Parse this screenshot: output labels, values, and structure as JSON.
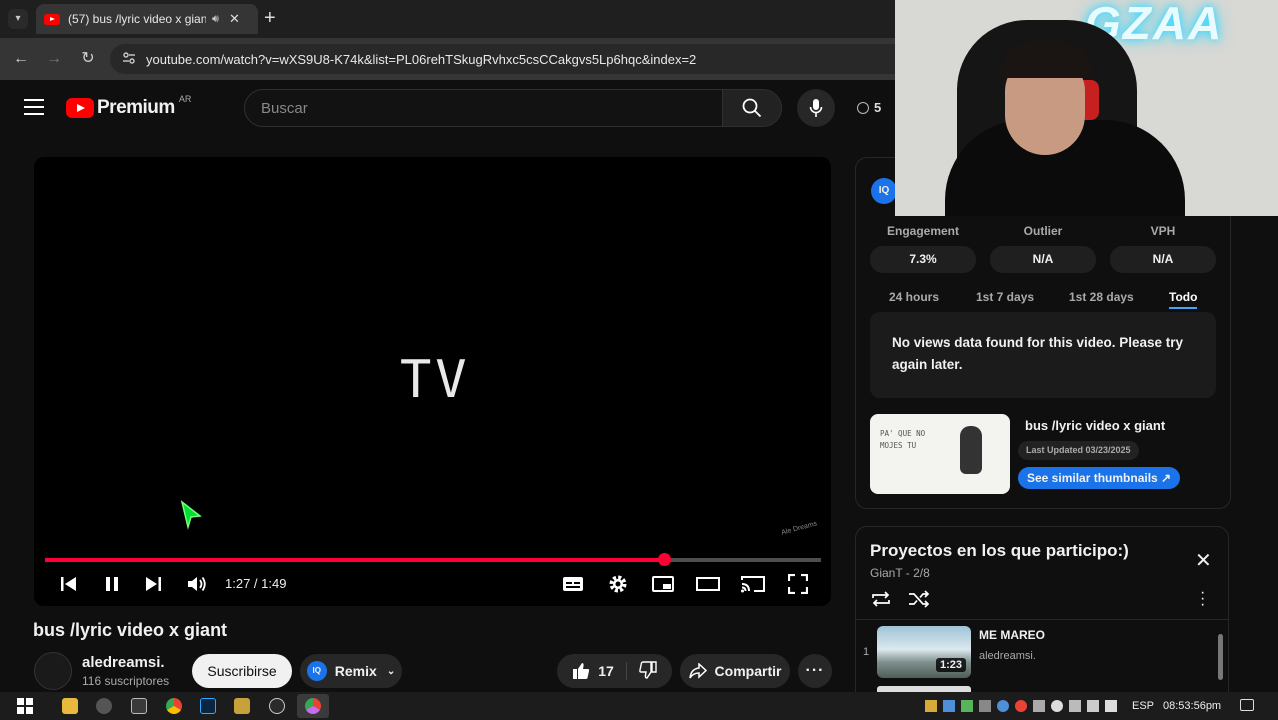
{
  "browser": {
    "tab_title": "(57) bus /lyric video x giant",
    "url": "youtube.com/watch?v=wXS9U8-K74k&list=PL06rehTSkugRvhxc5csCCakgvs5Lp6hqc&index=2"
  },
  "header": {
    "logo_text": "Premium",
    "region": "AR",
    "search_placeholder": "Buscar",
    "history_count": "5"
  },
  "player": {
    "lyric_text": "TV",
    "current_time": "1:27",
    "duration": "1:49",
    "time_display": "1:27 / 1:49",
    "progress_fraction": 0.798,
    "watermark": "Ale Dreams"
  },
  "video": {
    "title": "bus /lyric video x giant",
    "channel": "aledreamsi.",
    "subscribers": "116 suscriptores",
    "subscribe_label": "Suscribirse",
    "remix_label": "Remix",
    "likes": "17",
    "share_label": "Compartir"
  },
  "iq_panel": {
    "logo": "IQ",
    "metrics": [
      {
        "label": "Engagement",
        "value": "7.3%"
      },
      {
        "label": "Outlier",
        "value": "N/A"
      },
      {
        "label": "VPH",
        "value": "N/A"
      }
    ],
    "ranges": [
      "24 hours",
      "1st 7 days",
      "1st 28 days",
      "Todo"
    ],
    "active_range": "Todo",
    "no_data_message": "No views data found for this video. Please try again later.",
    "thumb_title": "bus /lyric video x giant",
    "last_updated": "Last Updated 03/23/2025",
    "similar_label": "See similar thumbnails ↗",
    "thumb_text": "PA' QUE NO MOJES TU"
  },
  "playlist": {
    "title": "Proyectos en los que participo:)",
    "owner": "GianT",
    "position": "2/8",
    "owner_position": "GianT - 2/8",
    "items": [
      {
        "index": "1",
        "title": "ME MAREO",
        "channel": "aledreamsi.",
        "duration": "1:23"
      }
    ]
  },
  "webcam_overlay_text": "GZAA",
  "taskbar": {
    "language": "ESP",
    "clock": "08:53:56pm"
  },
  "colors": {
    "accent_red": "#ff0033",
    "iq_blue": "#1a73e8"
  }
}
